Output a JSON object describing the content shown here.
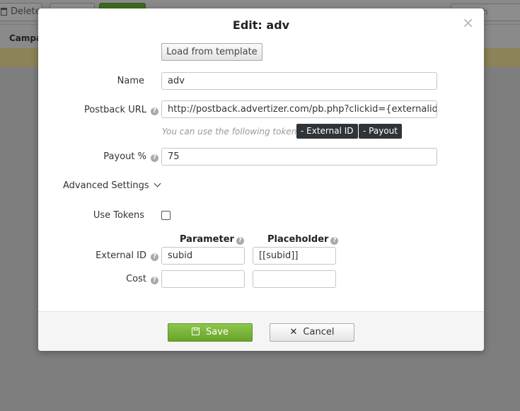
{
  "background": {
    "toolbar": {
      "delete_label": "Delete",
      "search_placeholder": "h"
    },
    "table_header": "Campa"
  },
  "modal": {
    "title": "Edit: adv",
    "close_glyph": "×",
    "load_template_label": "Load from template",
    "fields": {
      "name": {
        "label": "Name",
        "value": "adv"
      },
      "postback_url": {
        "label": "Postback URL",
        "value": "http://postback.advertizer.com/pb.php?clickid={externalid}&am"
      },
      "tokens_hint": "You can use the following tokens:",
      "tokens": [
        "- External ID",
        "- Payout"
      ],
      "payout": {
        "label": "Payout %",
        "value": "75"
      }
    },
    "advanced_settings_label": "Advanced Settings",
    "use_tokens_label": "Use Tokens",
    "use_tokens_checked": false,
    "params_table": {
      "col_parameter": "Parameter",
      "col_placeholder": "Placeholder",
      "rows": [
        {
          "label": "External ID",
          "parameter": "subid",
          "placeholder": "[[subid]]"
        },
        {
          "label": "Cost",
          "parameter": "",
          "placeholder": ""
        }
      ]
    },
    "help_glyph": "?",
    "footer": {
      "save_label": "Save",
      "cancel_label": "Cancel"
    }
  },
  "colors": {
    "save_green": "#7ab63b",
    "token_dark": "#2f3438",
    "overlay": "#7e7e7e"
  }
}
